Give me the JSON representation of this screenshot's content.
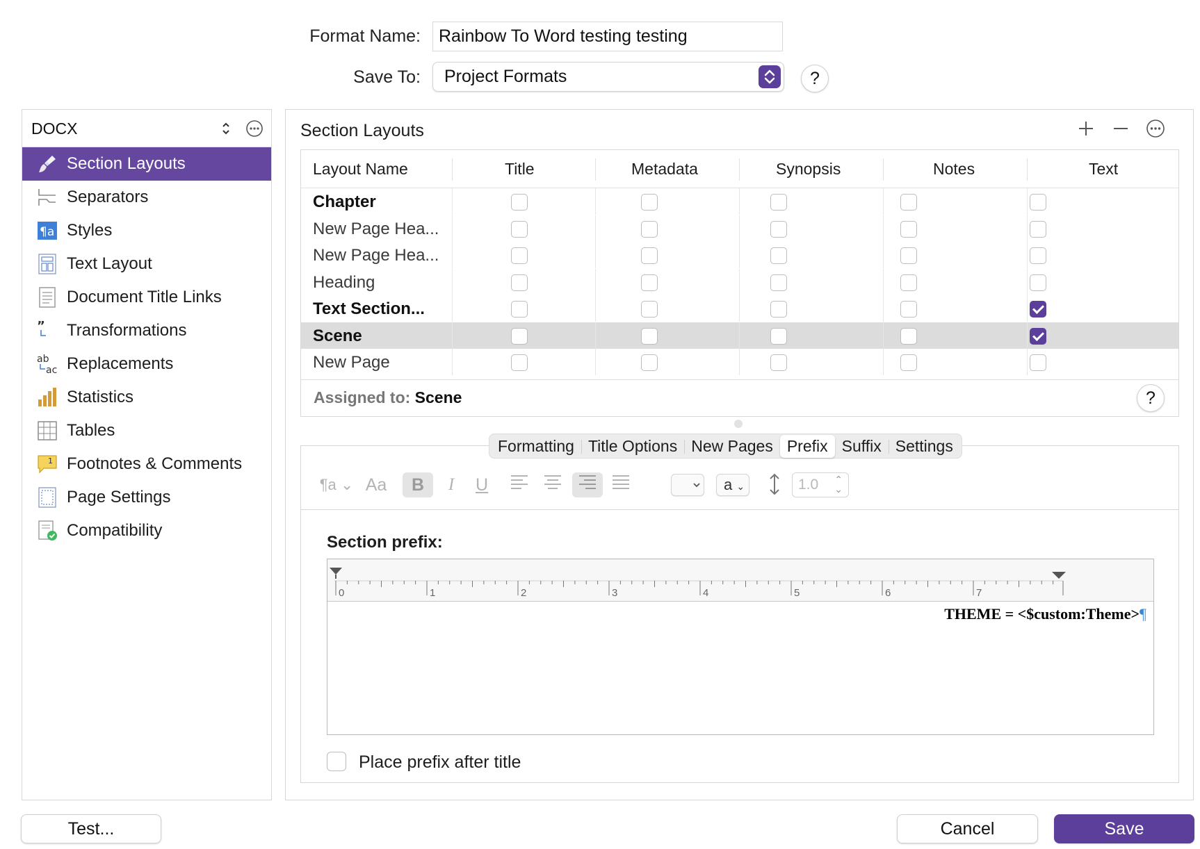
{
  "form": {
    "format_name_label": "Format Name:",
    "format_name_value": "Rainbow To Word testing testing",
    "save_to_label": "Save To:",
    "save_to_value": "Project Formats",
    "help_label": "?"
  },
  "sidebar": {
    "format_type": "DOCX",
    "items": [
      {
        "label": "Section Layouts",
        "icon": "paintbrush-icon",
        "selected": true
      },
      {
        "label": "Separators",
        "icon": "separators-icon"
      },
      {
        "label": "Styles",
        "icon": "styles-icon"
      },
      {
        "label": "Text Layout",
        "icon": "text-layout-icon"
      },
      {
        "label": "Document Title Links",
        "icon": "document-icon"
      },
      {
        "label": "Transformations",
        "icon": "quotes-icon"
      },
      {
        "label": "Replacements",
        "icon": "replace-icon"
      },
      {
        "label": "Statistics",
        "icon": "bar-chart-icon"
      },
      {
        "label": "Tables",
        "icon": "table-icon"
      },
      {
        "label": "Footnotes & Comments",
        "icon": "footnote-icon"
      },
      {
        "label": "Page Settings",
        "icon": "page-icon"
      },
      {
        "label": "Compatibility",
        "icon": "compatibility-icon"
      }
    ]
  },
  "section_layouts": {
    "title": "Section Layouts",
    "columns": [
      "Layout Name",
      "Title",
      "Metadata",
      "Synopsis",
      "Notes",
      "Text"
    ],
    "rows": [
      {
        "name": "Chapter",
        "bold": true,
        "checks": [
          false,
          false,
          false,
          false,
          false
        ]
      },
      {
        "name": "New Page Hea...",
        "bold": false,
        "checks": [
          false,
          false,
          false,
          false,
          false
        ]
      },
      {
        "name": "New Page Hea...",
        "bold": false,
        "checks": [
          false,
          false,
          false,
          false,
          false
        ]
      },
      {
        "name": "Heading",
        "bold": false,
        "checks": [
          false,
          false,
          false,
          false,
          false
        ]
      },
      {
        "name": "Text Section...",
        "bold": true,
        "checks": [
          false,
          false,
          false,
          false,
          true
        ]
      },
      {
        "name": "Scene",
        "bold": true,
        "selected": true,
        "checks": [
          false,
          false,
          false,
          false,
          true
        ]
      },
      {
        "name": "New Page",
        "bold": false,
        "checks": [
          false,
          false,
          false,
          false,
          false
        ]
      }
    ],
    "assigned_label": "Assigned to:",
    "assigned_value": "Scene"
  },
  "tabs": [
    {
      "label": "Formatting"
    },
    {
      "label": "Title Options"
    },
    {
      "label": "New Pages"
    },
    {
      "label": "Prefix",
      "active": true
    },
    {
      "label": "Suffix"
    },
    {
      "label": "Settings"
    }
  ],
  "toolbar": {
    "font_size_glyph": "Aa",
    "bold": "B",
    "italic": "I",
    "underline": "U",
    "case_value": "a",
    "line_spacing": "1.0"
  },
  "prefix": {
    "title": "Section prefix:",
    "content": "THEME = <$custom:Theme>",
    "ruler_numbers": [
      "0",
      "1",
      "2",
      "3",
      "4",
      "5",
      "6",
      "7"
    ],
    "place_after_title_label": "Place prefix after title"
  },
  "buttons": {
    "test": "Test...",
    "cancel": "Cancel",
    "save": "Save"
  },
  "colors": {
    "accent": "#5b3f9a",
    "sidebar_selected": "#65479f",
    "row_selected": "#dcdcdc"
  }
}
